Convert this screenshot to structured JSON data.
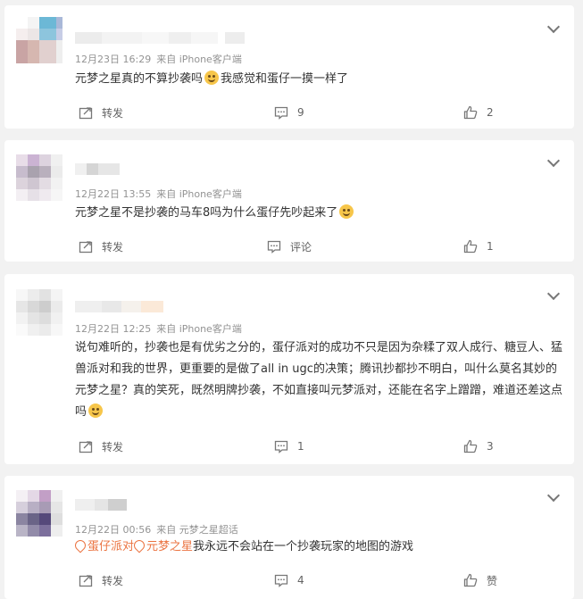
{
  "comments": [
    {
      "date": "12月23日 16:29",
      "source": "来自 iPhone客户端",
      "text_before": "元梦之星真的不算抄袭吗",
      "text_after": "我感觉和蛋仔一摸一样了",
      "emoji": "crying-laughing-emoji",
      "actions": {
        "repost": "转发",
        "comment": "9",
        "like": "2"
      }
    },
    {
      "date": "12月22日 13:55",
      "source": "来自 iPhone客户端",
      "text_before": "元梦之星不是抄袭的马车8吗为什么蛋仔先吵起来了",
      "emoji": "smile-emoji",
      "actions": {
        "repost": "转发",
        "comment": "评论",
        "like": "1"
      }
    },
    {
      "date": "12月22日 12:25",
      "source": "来自 iPhone客户端",
      "text_before": "说句难听的，抄袭也是有优劣之分的，蛋仔派对的成功不只是因为杂糅了双人成行、糖豆人、猛兽派对和我的世界，更重要的是做了all in ugc的决策；腾讯抄都抄不明白，叫什么莫名其妙的元梦之星？真的笑死，既然明牌抄袭，不如直接叫元梦派对，还能在名字上蹭蹭，难道还差这点吗",
      "emoji": "laughing-emoji",
      "actions": {
        "repost": "转发",
        "comment": "1",
        "like": "3"
      }
    },
    {
      "date": "12月22日 00:56",
      "source": "来自 元梦之星超话",
      "topic1": "蛋仔派对",
      "topic2": "元梦之星",
      "text_after": "我永远不会站在一个抄袭玩家的地图的游戏",
      "actions": {
        "repost": "转发",
        "comment": "4",
        "like": "赞"
      }
    }
  ],
  "colors": {
    "topic": "#eb7340",
    "meta": "#939393",
    "background": "#f2f2f2"
  }
}
